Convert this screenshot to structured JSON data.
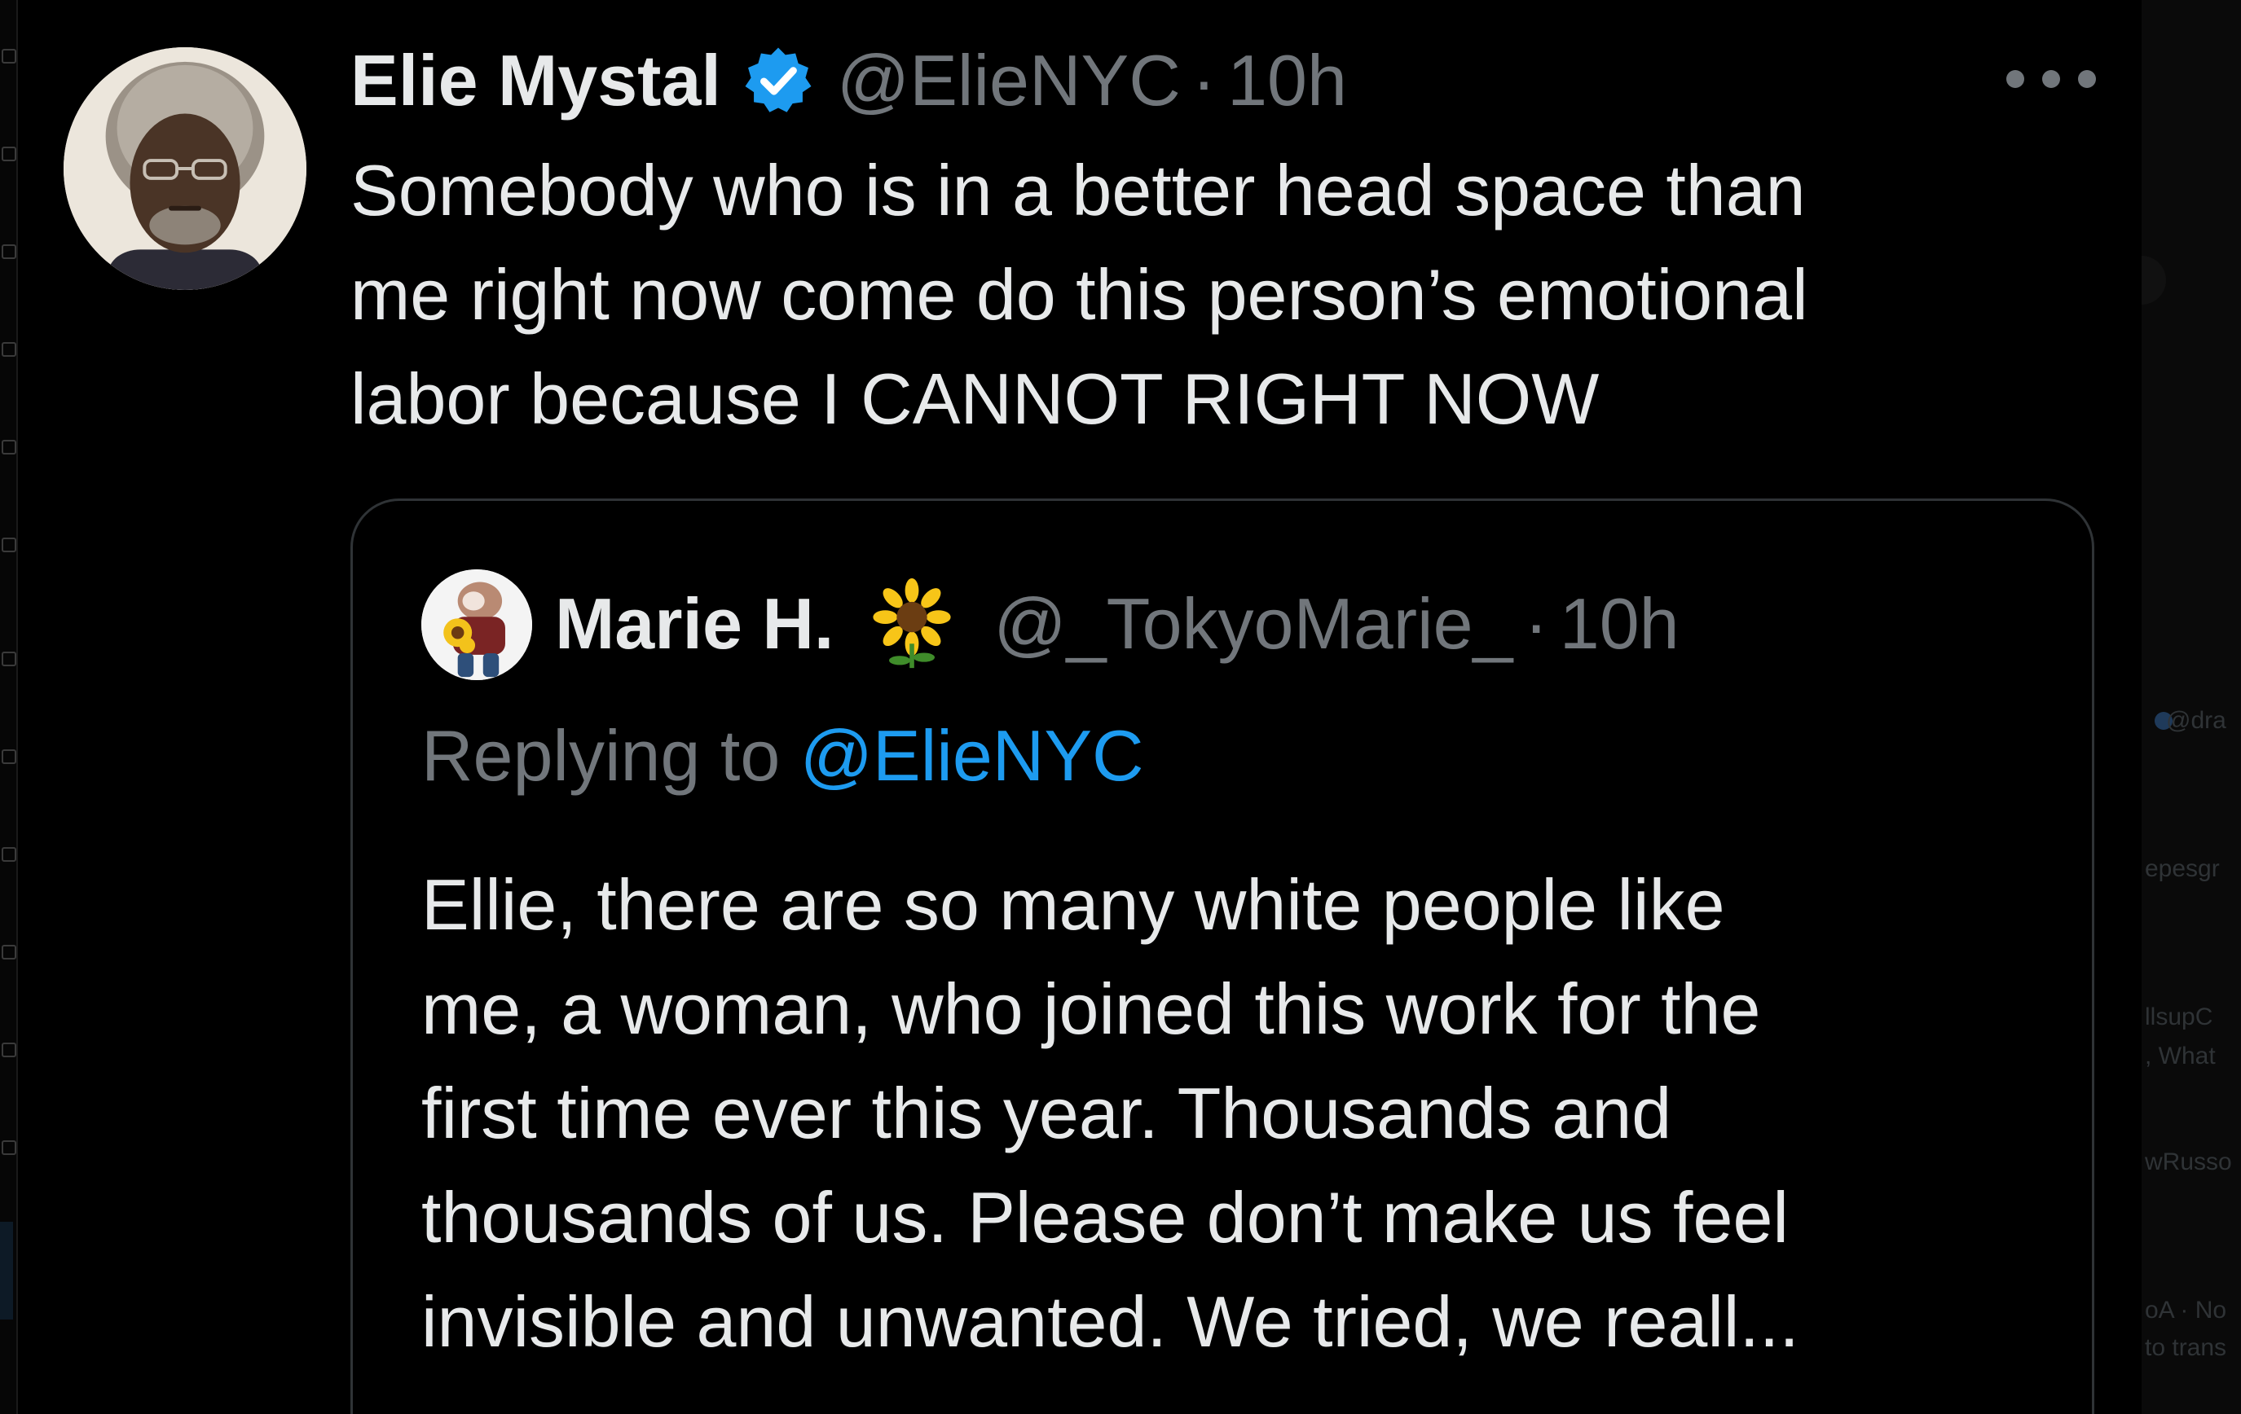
{
  "tweet": {
    "display_name": "Elie Mystal",
    "handle": "@ElieNYC",
    "separator": "·",
    "time": "10h",
    "text": "Somebody who is in a better head space than\nme right now come do this person’s emotional\nlabor because I CANNOT RIGHT NOW",
    "verified": true
  },
  "quoted_tweet": {
    "display_name": "Marie H.",
    "name_emoji": "sunflower-icon",
    "handle": "@_TokyoMarie_",
    "separator": "·",
    "time": "10h",
    "replying_prefix": "Replying to ",
    "replying_handle": "@ElieNYC",
    "text": "Ellie, there are so many white people like\nme, a woman, who joined this work for the\nfirst time ever this year. Thousands and\nthousands of us. Please don’t make us feel\ninvisible and unwanted. We tried, we reall..."
  },
  "right_sidebar_fragments": [
    "@dra",
    "epesgr",
    "llsupC",
    ", What",
    "wRusso",
    "oA · No",
    "to trans"
  ],
  "colors": {
    "background": "#000000",
    "primary_text": "#e7e9ea",
    "secondary_text": "#71767b",
    "link": "#1d9bf0",
    "border": "#2f3336",
    "verified_badge": "#1d9bf0"
  }
}
